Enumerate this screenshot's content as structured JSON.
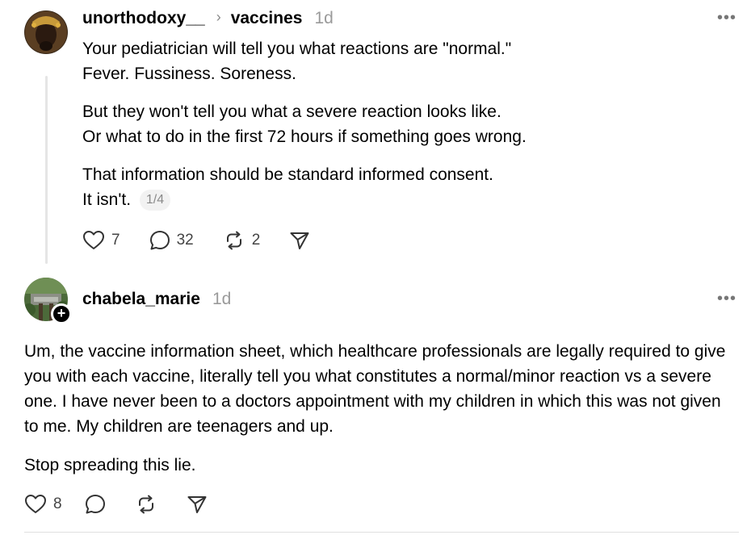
{
  "post1": {
    "username": "unorthodoxy__",
    "topic": "vaccines",
    "time": "1d",
    "more": "•••",
    "line1": "Your pediatrician will tell you what reactions are \"normal.\"",
    "line2": "Fever. Fussiness. Soreness.",
    "line3": "But they won't tell you what a severe reaction looks like.",
    "line4": "Or what to do in the first 72 hours if something goes wrong.",
    "line5": "That information should be standard informed consent.",
    "line6": "It isn't.",
    "pager": "1/4",
    "likes": "7",
    "replies": "32",
    "reposts": "2"
  },
  "post2": {
    "username": "chabela_marie",
    "time": "1d",
    "more": "•••",
    "follow_badge": "+",
    "para1": "Um, the vaccine information sheet, which healthcare professionals are legally required to give you with each vaccine, literally tell you what constitutes a normal/minor reaction vs a severe one. I have never been to a doctors appointment with my children in which this was not given to me. My children are teenagers and up.",
    "para2": "Stop spreading this lie.",
    "likes": "8"
  },
  "icons": [
    "heart-icon",
    "comment-icon",
    "repost-icon",
    "share-icon",
    "more-icon",
    "chevron-right-icon"
  ]
}
